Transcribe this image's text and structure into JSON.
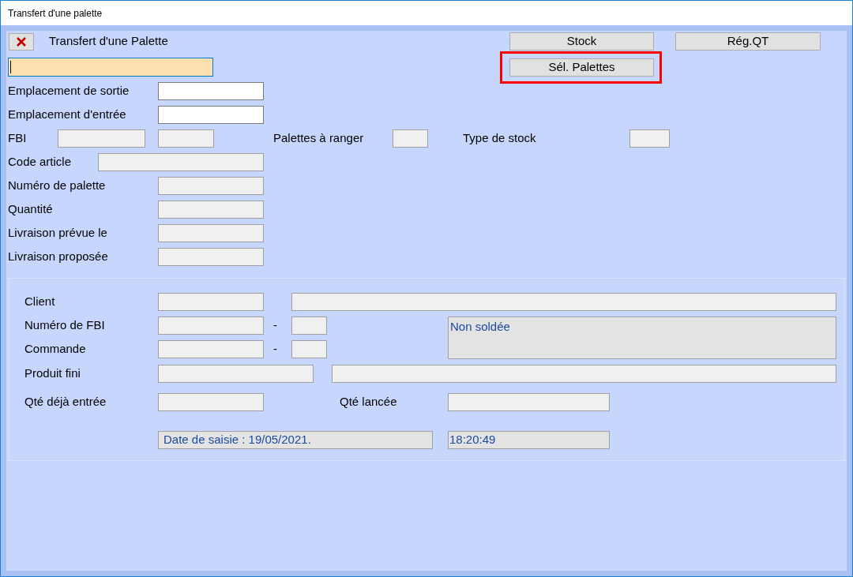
{
  "window": {
    "title": "Transfert d'une palette"
  },
  "form": {
    "title": "Transfert d'une Palette",
    "scan_field": {
      "focused": true
    },
    "buttons": [
      {
        "label": "Stock",
        "highlighted": false
      },
      {
        "label": "Rég.QT",
        "highlighted": false
      },
      {
        "label": "Sél. Palettes",
        "highlighted": true
      }
    ],
    "rows": [
      {
        "label": "Emplacement de sortie",
        "editable": true
      },
      {
        "label": "Emplacement d'entrée",
        "editable": true
      },
      {
        "label": "FBI",
        "editable": false
      },
      {
        "label": "Palettes à ranger",
        "editable": false
      },
      {
        "label": "Type de stock",
        "editable": false
      },
      {
        "label": "Code article",
        "editable": false
      },
      {
        "label": "Numéro de palette",
        "editable": false
      },
      {
        "label": "Quantité",
        "editable": false
      },
      {
        "label": "Livraison prévue le",
        "editable": false
      },
      {
        "label": "Livraison proposée",
        "editable": false
      }
    ]
  },
  "details": {
    "client": "Client",
    "fbi_number": "Numéro de FBI",
    "order": "Commande",
    "product": "Produit fini",
    "qty_entered": "Qté déjà entrée",
    "qty_launched": "Qté lancée",
    "separators": [
      "-",
      "-"
    ],
    "status": "Non soldée",
    "entry_date": "Date de saisie : 19/05/2021.",
    "entry_time": "18:20:49"
  }
}
